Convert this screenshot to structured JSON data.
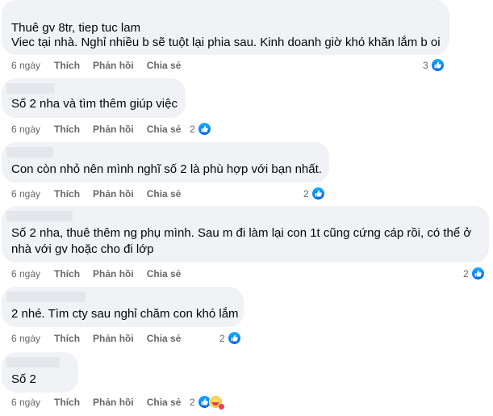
{
  "actions": {
    "time": "6 ngày",
    "like": "Thích",
    "reply": "Phản hồi",
    "share": "Chia sẻ"
  },
  "comments": [
    {
      "lines": [
        "Thuê gv 8tr, tiep tuc lam",
        "Viec tại nhà. Nghỉ nhiều b sẽ tuột lại phia sau. Kinh doanh giờ khó khăn lắm b oi"
      ],
      "reaction_count": "3",
      "reactions": [
        "like-icon"
      ]
    },
    {
      "lines": [
        "Số 2 nha và tìm thêm giúp việc"
      ],
      "reaction_count": "2",
      "reactions": [
        "like-icon"
      ]
    },
    {
      "lines": [
        "Con còn nhỏ nên mình nghĩ số 2 là phù hợp với bạn nhất."
      ],
      "reaction_count": "2",
      "reactions": [
        "like-icon"
      ]
    },
    {
      "lines": [
        "Số 2 nha, thuê thêm ng phụ mình. Sau m đi làm lại con 1t cũng cứng cáp rồi, có thể ở",
        "nhà với gv hoặc cho đi lớp"
      ],
      "reaction_count": "2",
      "reactions": [
        "like-icon"
      ]
    },
    {
      "lines": [
        "2 nhé. Tìm cty sau nghỉ chăm con khó lắm"
      ],
      "reaction_count": "2",
      "reactions": [
        "like-icon"
      ]
    },
    {
      "lines": [
        "Số 2"
      ],
      "reaction_count": "2",
      "reactions": [
        "like-icon",
        "care-icon"
      ]
    }
  ]
}
